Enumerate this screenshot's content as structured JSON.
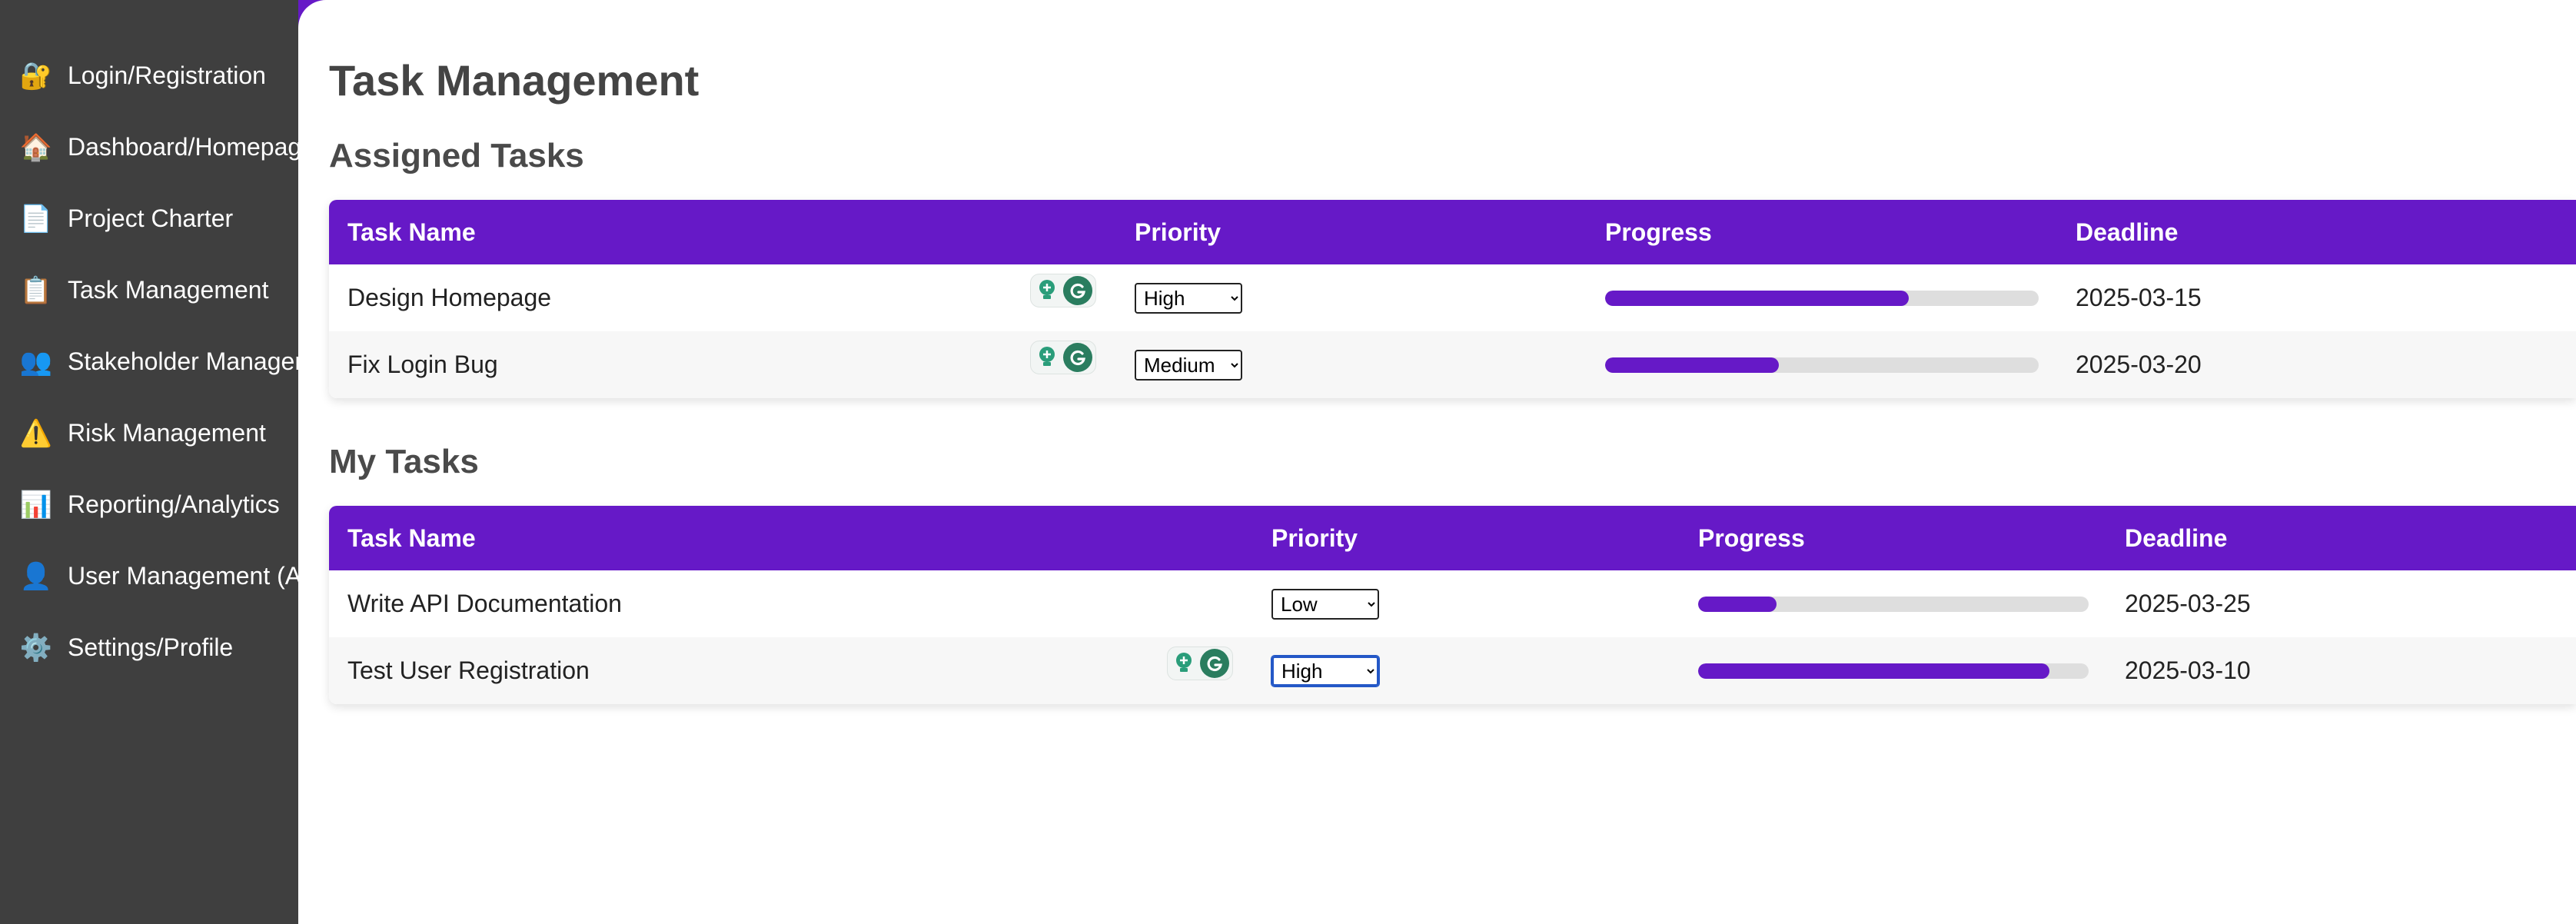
{
  "sidebar": {
    "items": [
      {
        "label": "Login/Registration",
        "icon": "lock-with-key-icon",
        "glyph": "🔐"
      },
      {
        "label": "Dashboard/Homepage",
        "icon": "house-icon",
        "glyph": "🏠"
      },
      {
        "label": "Project Charter",
        "icon": "document-icon",
        "glyph": "📄"
      },
      {
        "label": "Task Management",
        "icon": "clipboard-icon",
        "glyph": "📋"
      },
      {
        "label": "Stakeholder Management",
        "icon": "people-icon",
        "glyph": "👥"
      },
      {
        "label": "Risk Management",
        "icon": "warning-icon",
        "glyph": "⚠️"
      },
      {
        "label": "Reporting/Analytics",
        "icon": "bar-chart-icon",
        "glyph": "📊"
      },
      {
        "label": "User Management (Admin)",
        "icon": "user-icon",
        "glyph": "👤"
      },
      {
        "label": "Settings/Profile",
        "icon": "gear-icon",
        "glyph": "⚙️"
      }
    ]
  },
  "main": {
    "title": "Task Management",
    "assigned": {
      "title": "Assigned Tasks",
      "headers": {
        "task": "Task Name",
        "priority": "Priority",
        "progress": "Progress",
        "deadline": "Deadline"
      },
      "rows": [
        {
          "task": "Design Homepage",
          "priority": "High",
          "progress": 70,
          "deadline": "2025-03-15"
        },
        {
          "task": "Fix Login Bug",
          "priority": "Medium",
          "progress": 40,
          "deadline": "2025-03-20"
        }
      ]
    },
    "my": {
      "title": "My Tasks",
      "headers": {
        "task": "Task Name",
        "priority": "Priority",
        "progress": "Progress",
        "deadline": "Deadline"
      },
      "rows": [
        {
          "task": "Write API Documentation",
          "priority": "Low",
          "progress": 20,
          "deadline": "2025-03-25"
        },
        {
          "task": "Test User Registration",
          "priority": "High",
          "progress": 90,
          "deadline": "2025-03-10"
        }
      ]
    },
    "priority_options": [
      "Low",
      "Medium",
      "High"
    ]
  },
  "colors": {
    "accent": "#6619c7",
    "sidebar_bg": "#3f3f3f",
    "extension_green": "#2a7d5f"
  }
}
